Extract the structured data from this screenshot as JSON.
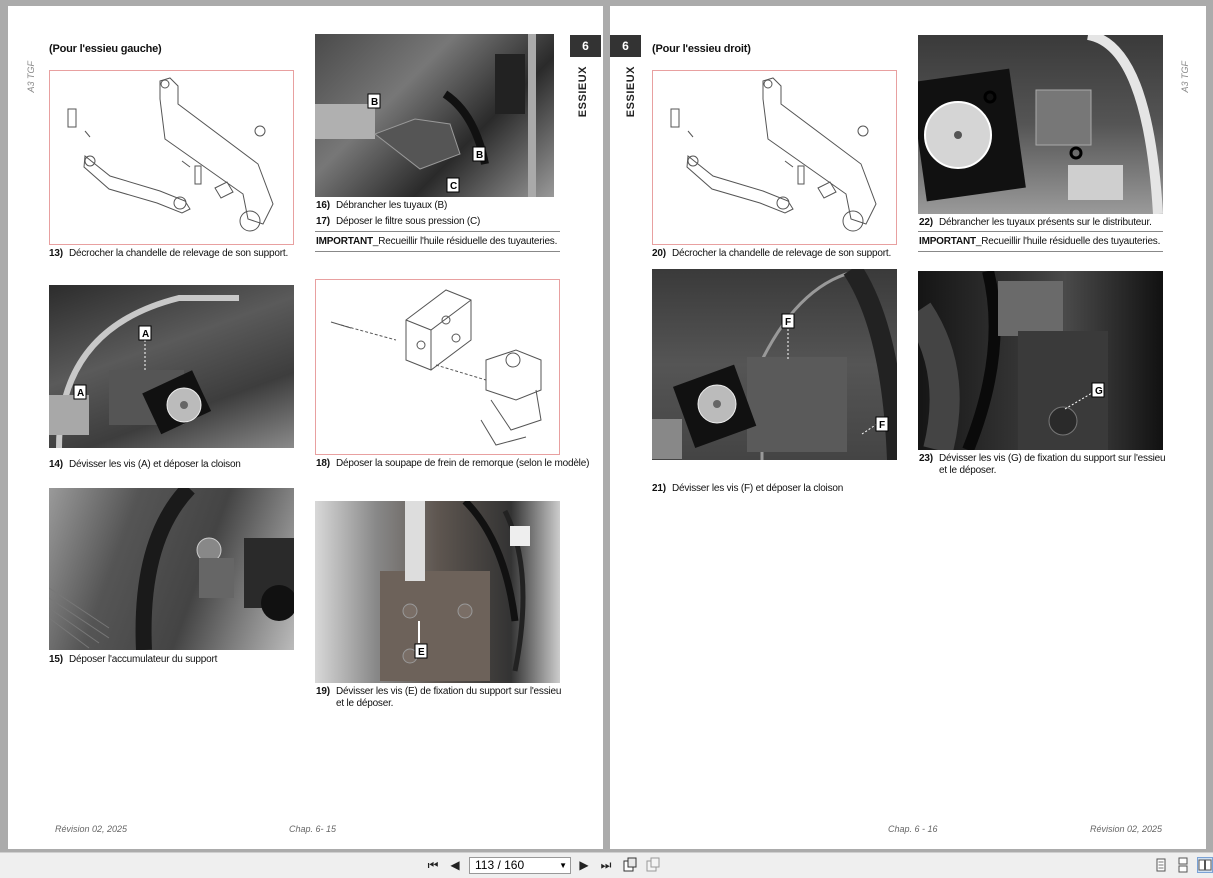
{
  "viewer": {
    "page_indicator": "113 / 160",
    "buttons": {
      "first": "⏮",
      "prev": "◀",
      "next": "▶",
      "last": "⏭"
    }
  },
  "left_page": {
    "side_label": "A3 TGF",
    "chapter_number": "6",
    "chapter_title": "ESSIEUX",
    "heading": "(Pour l'essieu gauche)",
    "steps": [
      {
        "num": "13)",
        "text": "Décrocher la chandelle de relevage de son support."
      },
      {
        "num": "14)",
        "text": "Dévisser les vis (A) et déposer la cloison"
      },
      {
        "num": "15)",
        "text": "Déposer l'accumulateur du support"
      },
      {
        "num": "16)",
        "text": "Débrancher les tuyaux (B)"
      },
      {
        "num": "17)",
        "text": "Déposer le filtre sous pression (C)"
      },
      {
        "num": "18)",
        "text": "Déposer la soupape de frein de remorque (selon le modèle)"
      },
      {
        "num": "19)",
        "text": "Dévisser les vis (E) de fixation du support sur l'essieu et le déposer."
      }
    ],
    "important": "IMPORTANT",
    "important_text": "_Recueillir l'huile résiduelle des tuyauteries.",
    "callouts": {
      "a": "A",
      "b": "B",
      "c": "C",
      "e": "E"
    },
    "footer_revision": "Révision 02, 2025",
    "footer_chapter": "Chap. 6- 15"
  },
  "right_page": {
    "side_label": "A3 TGF",
    "chapter_number": "6",
    "chapter_title": "ESSIEUX",
    "heading": "(Pour l'essieu droit)",
    "steps": [
      {
        "num": "20)",
        "text": "Décrocher la chandelle de relevage de son support."
      },
      {
        "num": "21)",
        "text": "Dévisser les vis (F) et déposer la cloison"
      },
      {
        "num": "22)",
        "text": "Débrancher les tuyaux présents sur le distributeur."
      },
      {
        "num": "23)",
        "text": "Dévisser les vis (G) de fixation du support sur l'essieu et le déposer."
      }
    ],
    "important": "IMPORTANT",
    "important_text": "_Recueillir l'huile résiduelle des tuyauteries.",
    "callouts": {
      "f": "F",
      "g": "G"
    },
    "footer_revision": "Révision 02, 2025",
    "footer_chapter": "Chap. 6 - 16"
  }
}
